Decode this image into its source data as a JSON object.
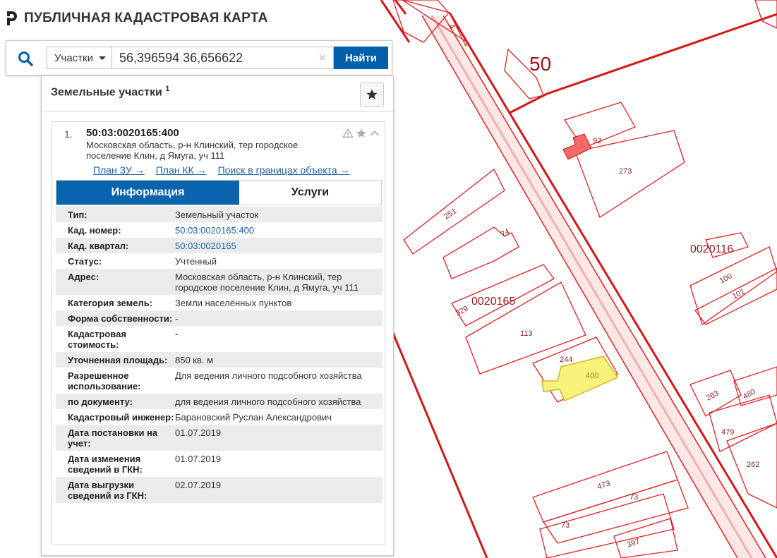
{
  "app": {
    "title": "ПУБЛИЧНАЯ КАДАСТРОВАЯ КАРТА"
  },
  "search": {
    "type_label": "Участки",
    "value": "56,396594 36,656622",
    "clear_glyph": "×",
    "find_label": "Найти"
  },
  "panel": {
    "heading": "Земельные участки",
    "count": "1"
  },
  "result": {
    "index": "1.",
    "cadastral_number": "50:03:0020165:400",
    "address": "Московская область, р-н Клинский, тер городское поселение Клин, д Ямуга, уч 111",
    "links": [
      "План ЗУ →",
      "План КК →",
      "Поиск в границах объекта →"
    ],
    "tabs": {
      "info": "Информация",
      "services": "Услуги"
    },
    "fields": [
      {
        "label": "Тип:",
        "value": "Земельный участок"
      },
      {
        "label": "Кад. номер:",
        "value": "50:03:0020165:400"
      },
      {
        "label": "Кад. квартал:",
        "value": "50:03:0020165"
      },
      {
        "label": "Статус:",
        "value": "Учтенный"
      },
      {
        "label": "Адрес:",
        "value": "Московская область, р-н Клинский, тер городское поселение Клин, д Ямуга, уч 111"
      },
      {
        "label": "Категория земель:",
        "value": "Земли населённых пунктов"
      },
      {
        "label": "Форма собственности:",
        "value": "-"
      },
      {
        "label": "Кадастровая стоимость:",
        "value": "-"
      },
      {
        "label": "Уточненная площадь:",
        "value": "850 кв. м"
      },
      {
        "label": "Разрешенное использование:",
        "value": "Для ведения личного подсобного хозяйства"
      },
      {
        "label": "по документу:",
        "value": "для ведения личного подсобного хозяйства"
      },
      {
        "label": "Кадастровый инженер:",
        "value": "Барановский Руслан Александрович"
      },
      {
        "label": "Дата постановки на учет:",
        "value": "01.07.2019"
      },
      {
        "label": "Дата изменения сведений в ГКН:",
        "value": "01.07.2019"
      },
      {
        "label": "Дата выгрузки сведений из ГКН:",
        "value": "02.07.2019"
      }
    ]
  },
  "map": {
    "region_label": "50",
    "quarter_labels": [
      "0020116",
      "0020165"
    ],
    "parcel_labels": [
      "4",
      "92",
      "273",
      "251",
      "74",
      "100",
      "101",
      "329",
      "113",
      "244",
      "400",
      "263",
      "480",
      "479",
      "262",
      "473",
      "73",
      "73",
      "397"
    ],
    "colors": {
      "boundary": "#e02020",
      "selected_fill": "#f6f27a",
      "highlight_fill": "#f06a6a",
      "brand": "#0060ac"
    }
  }
}
